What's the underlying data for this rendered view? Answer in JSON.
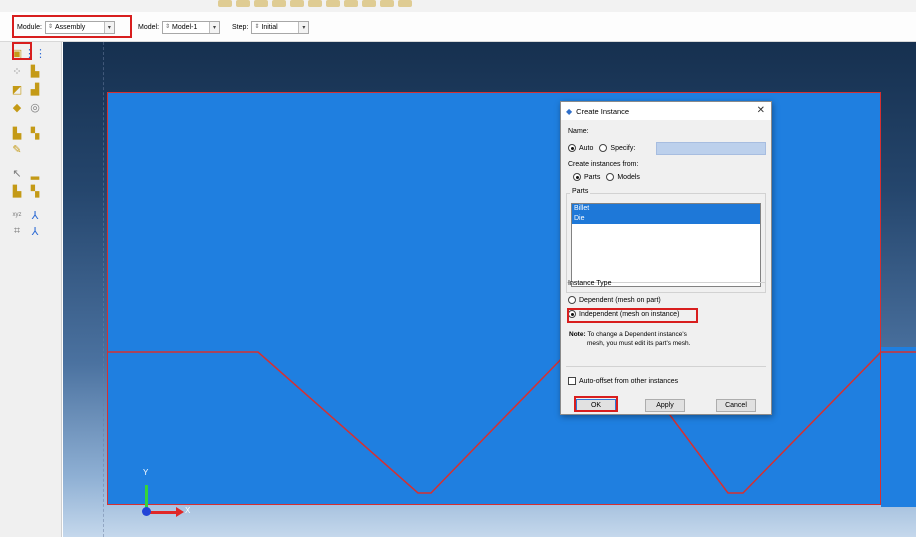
{
  "context_bar": {
    "module_label": "Module:",
    "module_value": "Assembly",
    "model_label": "Model:",
    "model_value": "Model-1",
    "step_label": "Step:",
    "step_value": "Initial"
  },
  "toolbox": {
    "tools": [
      "create-instance-icon",
      "linear-pattern-icon",
      "translate-icon",
      "rotate-icon",
      "translate-to-icon",
      "constraint-icon",
      "merge-cut-icon",
      "datum-point-icon",
      "datum-axis-icon",
      "datum-plane-icon",
      "datum-csys-icon",
      "partition-icon",
      "set-icon",
      "surface-icon",
      "coordinate-system-icon",
      "axis-triad-icon",
      "reference-point-icon"
    ]
  },
  "dialog": {
    "title": "Create Instance",
    "name_label": "Name:",
    "auto_label": "Auto",
    "specify_label": "Specify:",
    "create_from_label": "Create instances from:",
    "parts_option": "Parts",
    "models_option": "Models",
    "parts_group_title": "Parts",
    "parts": [
      "Billet",
      "Die"
    ],
    "instance_type_title": "Instance Type",
    "dependent_label": "Dependent (mesh on part)",
    "independent_label": "Independent (mesh on instance)",
    "note_label": "Note:",
    "note_line1": "To change a Dependent instance's",
    "note_line2": "mesh, you must edit its part's mesh.",
    "auto_offset_label": "Auto-offset from other instances",
    "ok_label": "OK",
    "apply_label": "Apply",
    "cancel_label": "Cancel"
  },
  "viewport": {
    "y_axis_label": "Y",
    "x_axis_label": "X"
  },
  "colors": {
    "part_fill": "#1f7fe0",
    "highlight": "#d81e1e",
    "edge": "#d63030"
  }
}
